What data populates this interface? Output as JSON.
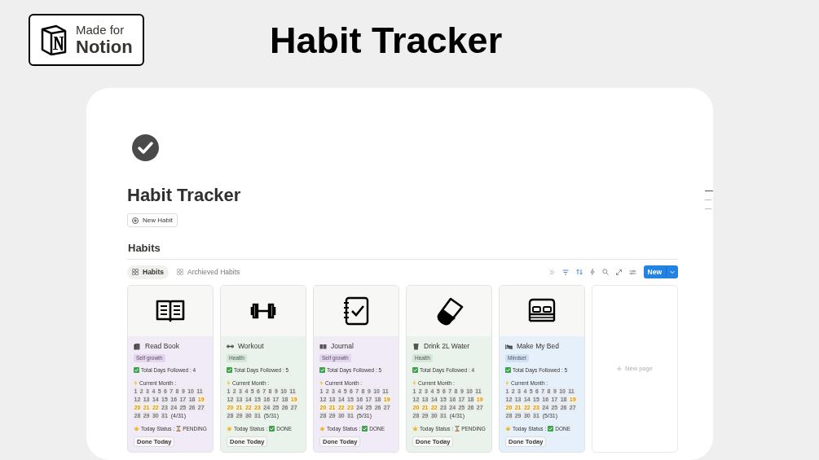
{
  "badge": {
    "line_1": "Made for",
    "line_2": "Notion"
  },
  "banner_title": "Habit Tracker",
  "page": {
    "title": "Habit Tracker",
    "new_button": "New Habit",
    "section_heading": "Habits"
  },
  "tabs": [
    {
      "label": "Habits",
      "selected": true
    },
    {
      "label": "Archieved Habits",
      "selected": false
    }
  ],
  "new_button": "New",
  "cards": [
    {
      "kind": "book",
      "title": "Read Book",
      "tag": {
        "label": "Self growth",
        "color": "#e4d4f0"
      },
      "color": "#f1eaf7",
      "total": "Total Days Followed : 4",
      "month_label": "Current Month :",
      "count": "(4/31)",
      "status_label": "Today Status :",
      "status": "PENDING",
      "done": false,
      "button": "Done Today",
      "days": [
        {
          "d": "1",
          "on": false
        },
        {
          "d": "2",
          "on": false
        },
        {
          "d": "3",
          "on": false
        },
        {
          "d": "4",
          "on": false
        },
        {
          "d": "5",
          "on": false
        },
        {
          "d": "6",
          "on": false
        },
        {
          "d": "7",
          "on": false
        },
        {
          "d": "8",
          "on": false
        },
        {
          "d": "9",
          "on": false
        },
        {
          "d": "10",
          "on": false
        },
        {
          "d": "11",
          "on": false
        },
        {
          "d": "12",
          "on": false
        },
        {
          "d": "13",
          "on": false
        },
        {
          "d": "14",
          "on": false
        },
        {
          "d": "15",
          "on": false
        },
        {
          "d": "16",
          "on": false
        },
        {
          "d": "17",
          "on": false
        },
        {
          "d": "18",
          "on": false
        },
        {
          "d": "19",
          "on": true
        },
        {
          "d": "20",
          "on": true
        },
        {
          "d": "21",
          "on": true
        },
        {
          "d": "22",
          "on": true
        },
        {
          "d": "23",
          "on": false
        },
        {
          "d": "24",
          "on": false
        },
        {
          "d": "25",
          "on": false
        },
        {
          "d": "26",
          "on": false
        },
        {
          "d": "27",
          "on": false
        },
        {
          "d": "28",
          "on": false
        },
        {
          "d": "29",
          "on": false
        },
        {
          "d": "30",
          "on": false
        },
        {
          "d": "31",
          "on": false
        }
      ]
    },
    {
      "kind": "dumbbell",
      "title": "Workout",
      "tag": {
        "label": "Health",
        "color": "#d3e6d7"
      },
      "color": "#eaf2ec",
      "total": "Total Days Followed : 5",
      "month_label": "Current Month :",
      "count": "(5/31)",
      "status_label": "Today Status :",
      "status": "DONE",
      "done": true,
      "button": "Done Today",
      "days": [
        {
          "d": "1",
          "on": false
        },
        {
          "d": "2",
          "on": false
        },
        {
          "d": "3",
          "on": false
        },
        {
          "d": "4",
          "on": false
        },
        {
          "d": "5",
          "on": false
        },
        {
          "d": "6",
          "on": false
        },
        {
          "d": "7",
          "on": false
        },
        {
          "d": "8",
          "on": false
        },
        {
          "d": "9",
          "on": false
        },
        {
          "d": "10",
          "on": false
        },
        {
          "d": "11",
          "on": false
        },
        {
          "d": "12",
          "on": false
        },
        {
          "d": "13",
          "on": false
        },
        {
          "d": "14",
          "on": false
        },
        {
          "d": "15",
          "on": false
        },
        {
          "d": "16",
          "on": false
        },
        {
          "d": "17",
          "on": false
        },
        {
          "d": "18",
          "on": false
        },
        {
          "d": "19",
          "on": true
        },
        {
          "d": "20",
          "on": true
        },
        {
          "d": "21",
          "on": true
        },
        {
          "d": "22",
          "on": true
        },
        {
          "d": "23",
          "on": true
        },
        {
          "d": "24",
          "on": false
        },
        {
          "d": "25",
          "on": false
        },
        {
          "d": "26",
          "on": false
        },
        {
          "d": "27",
          "on": false
        },
        {
          "d": "28",
          "on": false
        },
        {
          "d": "29",
          "on": false
        },
        {
          "d": "30",
          "on": false
        },
        {
          "d": "31",
          "on": false
        }
      ]
    },
    {
      "kind": "journal",
      "title": "Journal",
      "tag": {
        "label": "Self growth",
        "color": "#e4d4f0"
      },
      "color": "#f1eaf7",
      "total": "Total Days Followed : 5",
      "month_label": "Current Month :",
      "count": "(5/31)",
      "status_label": "Today Status :",
      "status": "DONE",
      "done": true,
      "button": "Done Today",
      "days": [
        {
          "d": "1",
          "on": false
        },
        {
          "d": "2",
          "on": false
        },
        {
          "d": "3",
          "on": false
        },
        {
          "d": "4",
          "on": false
        },
        {
          "d": "5",
          "on": false
        },
        {
          "d": "6",
          "on": false
        },
        {
          "d": "7",
          "on": false
        },
        {
          "d": "8",
          "on": false
        },
        {
          "d": "9",
          "on": false
        },
        {
          "d": "10",
          "on": false
        },
        {
          "d": "11",
          "on": false
        },
        {
          "d": "12",
          "on": false
        },
        {
          "d": "13",
          "on": false
        },
        {
          "d": "14",
          "on": false
        },
        {
          "d": "15",
          "on": false
        },
        {
          "d": "16",
          "on": false
        },
        {
          "d": "17",
          "on": false
        },
        {
          "d": "18",
          "on": false
        },
        {
          "d": "19",
          "on": true
        },
        {
          "d": "20",
          "on": true
        },
        {
          "d": "21",
          "on": true
        },
        {
          "d": "22",
          "on": true
        },
        {
          "d": "23",
          "on": true
        },
        {
          "d": "24",
          "on": false
        },
        {
          "d": "25",
          "on": false
        },
        {
          "d": "26",
          "on": false
        },
        {
          "d": "27",
          "on": false
        },
        {
          "d": "28",
          "on": false
        },
        {
          "d": "29",
          "on": false
        },
        {
          "d": "30",
          "on": false
        },
        {
          "d": "31",
          "on": false
        }
      ]
    },
    {
      "kind": "glass",
      "title": "Drink 2L Water",
      "tag": {
        "label": "Health",
        "color": "#d3e6d7"
      },
      "color": "#eaf2ec",
      "total": "Total Days Followed : 4",
      "month_label": "Current Month :",
      "count": "(4/31)",
      "status_label": "Today Status :",
      "status": "PENDING",
      "done": false,
      "button": "Done Today",
      "days": [
        {
          "d": "1",
          "on": false
        },
        {
          "d": "2",
          "on": false
        },
        {
          "d": "3",
          "on": false
        },
        {
          "d": "4",
          "on": false
        },
        {
          "d": "5",
          "on": false
        },
        {
          "d": "6",
          "on": false
        },
        {
          "d": "7",
          "on": false
        },
        {
          "d": "8",
          "on": false
        },
        {
          "d": "9",
          "on": false
        },
        {
          "d": "10",
          "on": false
        },
        {
          "d": "11",
          "on": false
        },
        {
          "d": "12",
          "on": false
        },
        {
          "d": "13",
          "on": false
        },
        {
          "d": "14",
          "on": false
        },
        {
          "d": "15",
          "on": false
        },
        {
          "d": "16",
          "on": false
        },
        {
          "d": "17",
          "on": false
        },
        {
          "d": "18",
          "on": false
        },
        {
          "d": "19",
          "on": true
        },
        {
          "d": "20",
          "on": true
        },
        {
          "d": "21",
          "on": true
        },
        {
          "d": "22",
          "on": true
        },
        {
          "d": "23",
          "on": false
        },
        {
          "d": "24",
          "on": false
        },
        {
          "d": "25",
          "on": false
        },
        {
          "d": "26",
          "on": false
        },
        {
          "d": "27",
          "on": false
        },
        {
          "d": "28",
          "on": false
        },
        {
          "d": "29",
          "on": false
        },
        {
          "d": "30",
          "on": false
        },
        {
          "d": "31",
          "on": false
        }
      ]
    },
    {
      "kind": "bed",
      "title": "Make My Bed",
      "tag": {
        "label": "Mindset",
        "color": "#cfe1f5"
      },
      "color": "#e6f0fa",
      "total": "Total Days Followed : 5",
      "month_label": "Current Month :",
      "count": "(5/31)",
      "status_label": "Today Status :",
      "status": "DONE",
      "done": true,
      "button": "Done Today",
      "days": [
        {
          "d": "1",
          "on": false
        },
        {
          "d": "2",
          "on": false
        },
        {
          "d": "3",
          "on": false
        },
        {
          "d": "4",
          "on": false
        },
        {
          "d": "5",
          "on": false
        },
        {
          "d": "6",
          "on": false
        },
        {
          "d": "7",
          "on": false
        },
        {
          "d": "8",
          "on": false
        },
        {
          "d": "9",
          "on": false
        },
        {
          "d": "10",
          "on": false
        },
        {
          "d": "11",
          "on": false
        },
        {
          "d": "12",
          "on": false
        },
        {
          "d": "13",
          "on": false
        },
        {
          "d": "14",
          "on": false
        },
        {
          "d": "15",
          "on": false
        },
        {
          "d": "16",
          "on": false
        },
        {
          "d": "17",
          "on": false
        },
        {
          "d": "18",
          "on": false
        },
        {
          "d": "19",
          "on": true
        },
        {
          "d": "20",
          "on": true
        },
        {
          "d": "21",
          "on": true
        },
        {
          "d": "22",
          "on": true
        },
        {
          "d": "23",
          "on": true
        },
        {
          "d": "24",
          "on": false
        },
        {
          "d": "25",
          "on": false
        },
        {
          "d": "26",
          "on": false
        },
        {
          "d": "27",
          "on": false
        },
        {
          "d": "28",
          "on": false
        },
        {
          "d": "29",
          "on": false
        },
        {
          "d": "30",
          "on": false
        },
        {
          "d": "31",
          "on": false
        }
      ]
    }
  ],
  "new_page": "New page"
}
